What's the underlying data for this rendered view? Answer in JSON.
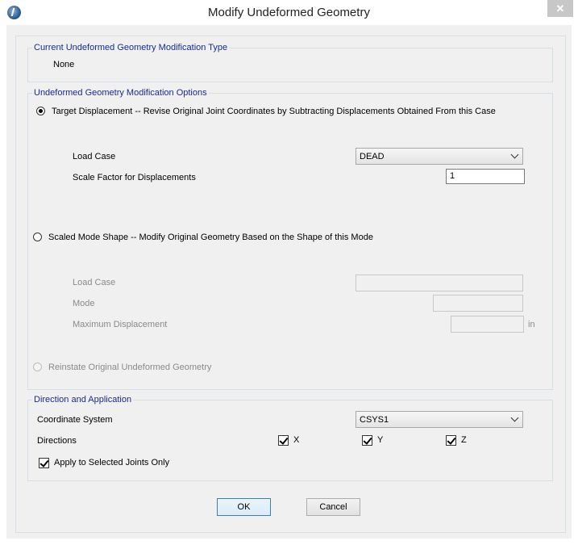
{
  "window": {
    "title": "Modify Undeformed Geometry",
    "close_glyph": "✕"
  },
  "current_type": {
    "legend": "Current Undeformed Geometry Modification Type",
    "value": "None"
  },
  "options": {
    "legend": "Undeformed Geometry Modification Options",
    "target": {
      "label": "Target Displacement -- Revise Original Joint Coordinates by Subtracting Displacements Obtained From this Case",
      "selected": true,
      "load_case_label": "Load Case",
      "load_case_value": "DEAD",
      "scale_label": "Scale Factor for Displacements",
      "scale_value": "1"
    },
    "scaled": {
      "label": "Scaled Mode Shape -- Modify Original Geometry Based on the Shape of this Mode",
      "selected": false,
      "load_case_label": "Load Case",
      "load_case_value": "",
      "mode_label": "Mode",
      "mode_value": "",
      "max_disp_label": "Maximum Displacement",
      "max_disp_value": "",
      "unit": "in"
    },
    "reinstate": {
      "label": "Reinstate Original Undeformed Geometry",
      "selected": false,
      "enabled": false
    }
  },
  "direction": {
    "legend": "Direction and Application",
    "coord_label": "Coordinate System",
    "coord_value": "CSYS1",
    "directions_label": "Directions",
    "x_label": "X",
    "x_checked": true,
    "y_label": "Y",
    "y_checked": true,
    "z_label": "Z",
    "z_checked": true,
    "apply_label": "Apply to Selected Joints Only",
    "apply_checked": true
  },
  "buttons": {
    "ok": "OK",
    "cancel": "Cancel"
  }
}
